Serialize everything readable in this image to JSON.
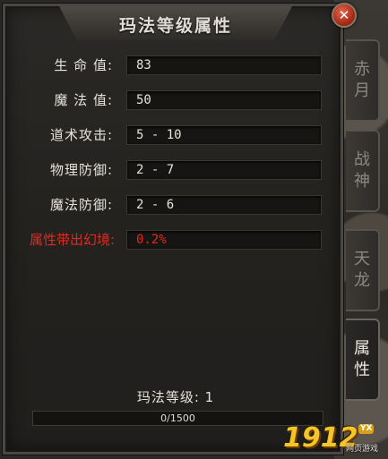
{
  "title": "玛法等级属性",
  "close_symbol": "✕",
  "attributes": [
    {
      "label": "生 命 值:",
      "value": "83"
    },
    {
      "label": "魔 法 值:",
      "value": "50"
    },
    {
      "label": "道术攻击:",
      "value": "5 - 10"
    },
    {
      "label": "物理防御:",
      "value": "2 - 7"
    },
    {
      "label": "魔法防御:",
      "value": "2 - 6"
    },
    {
      "label": "属性带出幻境:",
      "value": "0.2%"
    }
  ],
  "level_text": "玛法等级: 1",
  "progress": {
    "text": "0/1500",
    "fraction": 0
  },
  "tabs": [
    {
      "label1": "赤",
      "label2": "月"
    },
    {
      "label1": "战",
      "label2": "神"
    },
    {
      "label1": "天",
      "label2": "龙"
    },
    {
      "label1": "属",
      "label2": "性"
    }
  ],
  "logo": {
    "num": "1912",
    "yx": "YX",
    "sub": "网页游戏"
  },
  "colors": {
    "highlight_red": "#e02a20",
    "text": "#e6e2da"
  }
}
